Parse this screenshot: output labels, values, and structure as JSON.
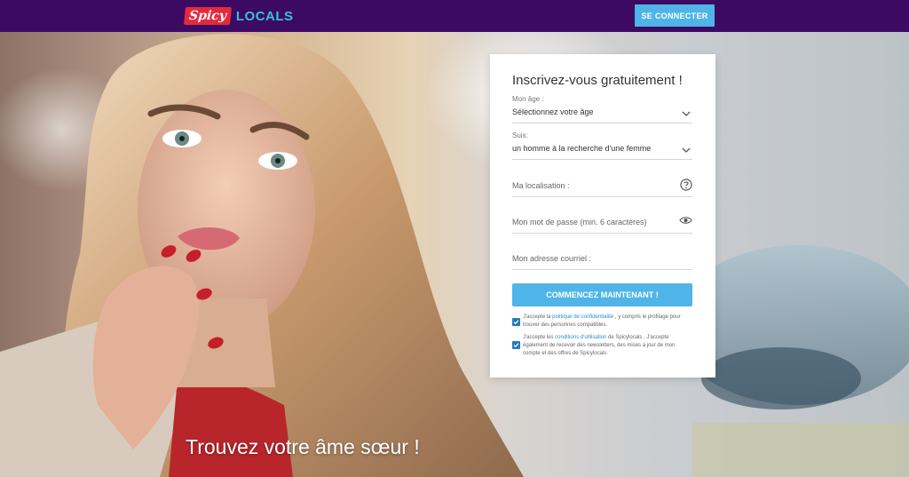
{
  "header": {
    "logo_part1": "Spicy",
    "logo_part2": "LOCALS",
    "login_label": "SE CONNECTER"
  },
  "hero": {
    "headline": "Trouvez votre âme sœur !"
  },
  "form": {
    "title": "Inscrivez-vous gratuitement !",
    "age": {
      "label": "Mon âge :",
      "value": "Sélectionnez votre âge"
    },
    "suis": {
      "label": "Suis:",
      "value": "un homme à la recherche d'une femme"
    },
    "location": {
      "placeholder": "Ma localisation :"
    },
    "password": {
      "placeholder": "Mon mot de passe (min. 6 caractères)"
    },
    "email": {
      "placeholder": "Mon adresse courriel :"
    },
    "submit_label": "COMMENCEZ MAINTENANT !",
    "consent_privacy": {
      "checked": true,
      "before": "J'accepte la ",
      "link": "politique de confidentialité",
      "after": " , y compris le profilage pour trouver des personnes compatibles."
    },
    "consent_terms": {
      "checked": true,
      "before": "J'accepte les ",
      "link": "conditions d'utilisation",
      "after": " de Spicylocals . J'accepte également de recevoir des newsletters, des mises à jour de mon compte et des offres de Spicylocals."
    }
  },
  "colors": {
    "header_bg": "#3c0a63",
    "accent": "#4fb4e8",
    "logo_red": "#e22a3c",
    "logo_cyan": "#36c3d8"
  }
}
